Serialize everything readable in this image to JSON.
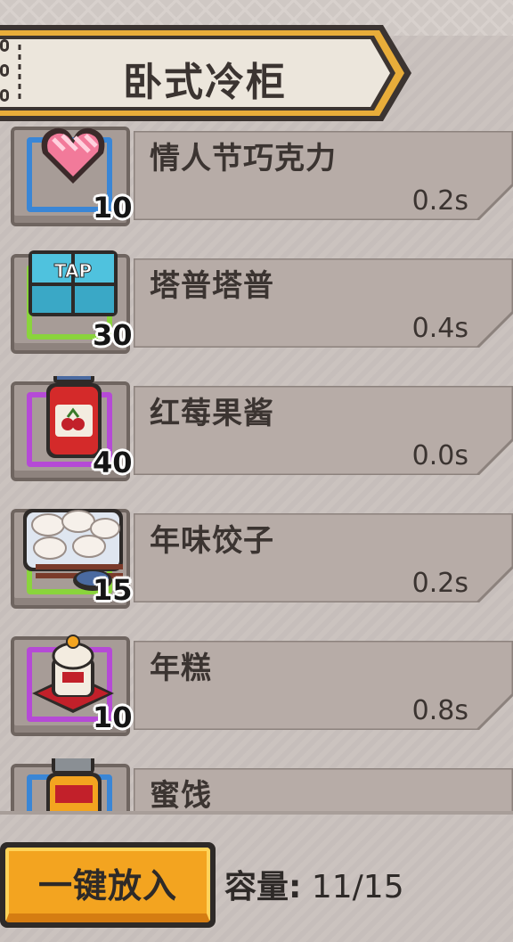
{
  "title": "卧式冷柜",
  "items": [
    {
      "name": "情人节巧克力",
      "count": "10",
      "time": "0.2s",
      "icon": "heart-chocolate-icon",
      "slot_color": "#3a86d6"
    },
    {
      "name": "塔普塔普",
      "count": "30",
      "time": "0.4s",
      "icon": "tap-tile-icon",
      "slot_color": "#8ad43c"
    },
    {
      "name": "红莓果酱",
      "count": "40",
      "time": "0.0s",
      "icon": "berry-jam-jar-icon",
      "slot_color": "#b54ad6"
    },
    {
      "name": "年味饺子",
      "count": "15",
      "time": "0.2s",
      "icon": "dumplings-icon",
      "slot_color": "#8ad43c"
    },
    {
      "name": "年糕",
      "count": "10",
      "time": "0.8s",
      "icon": "rice-cake-icon",
      "slot_color": "#b54ad6"
    },
    {
      "name": "蜜饯",
      "count": "",
      "time": "",
      "icon": "candied-fruit-jar-icon",
      "slot_color": "#3a86d6"
    }
  ],
  "footer": {
    "load_all_label": "一键放入",
    "capacity_label": "容量:",
    "capacity_value": "11/15"
  },
  "colors": {
    "accent": "#f3a420",
    "banner_border": "#e8ad3a",
    "text": "#3b3431"
  }
}
